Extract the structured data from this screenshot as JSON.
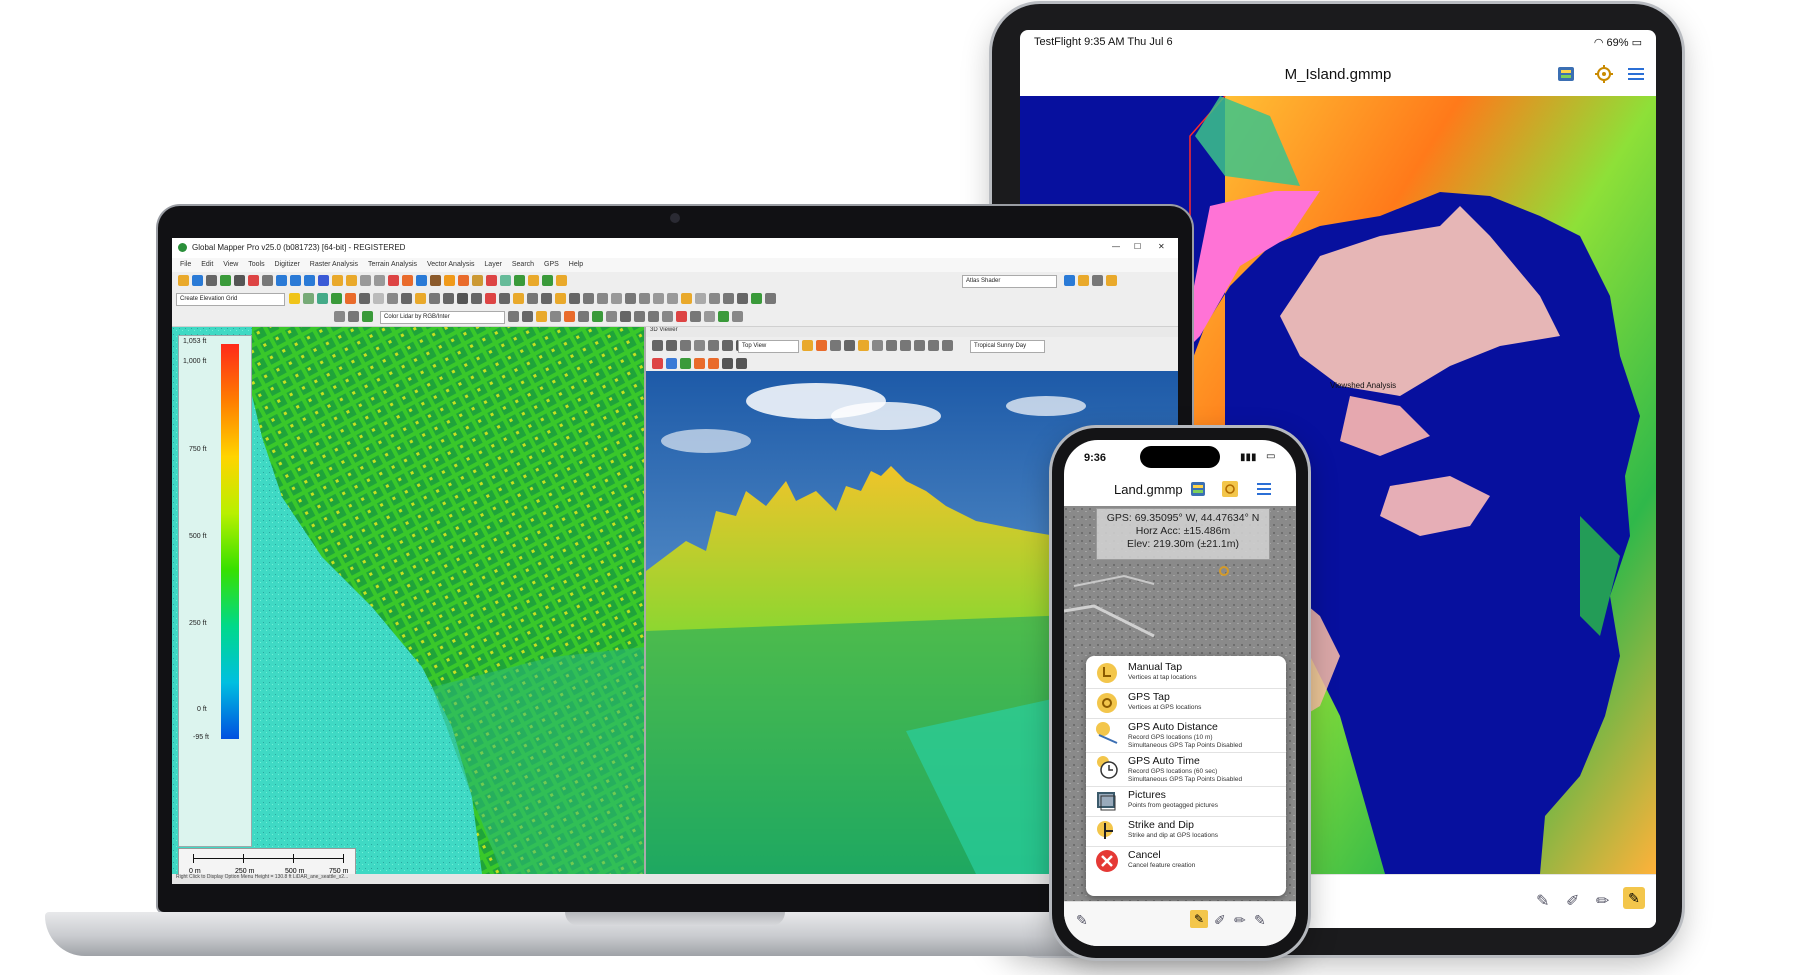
{
  "ipad": {
    "status_left": "TestFlight  9:35 AM   Thu Jul 6",
    "status_right": "69%",
    "title": "M_Island.gmmp",
    "map_label": "Viewshed Analysis",
    "icons": [
      "layers-icon",
      "locate-icon",
      "menu-icon"
    ],
    "bottom_tools": [
      "draw-line-icon",
      "draw-area-icon",
      "measure-icon",
      "digitize-icon"
    ]
  },
  "laptop": {
    "window_title": "Global Mapper Pro v25.0 (b081723) [64-bit] - REGISTERED",
    "menu": [
      "File",
      "Edit",
      "View",
      "Tools",
      "Digitizer",
      "Raster Analysis",
      "Terrain Analysis",
      "Vector Analysis",
      "Layer",
      "Search",
      "GPS",
      "Help"
    ],
    "combo_shader": "Atlas Shader",
    "combo_elev": "Create Elevation Grid",
    "combo_color": "Color Lidar by RGB/Inter",
    "view3d_title": "3D Viewer",
    "combo_view": "Top View",
    "combo_sky": "Tropical Sunny Day",
    "legend_ticks": [
      "1,053 ft",
      "1,000 ft",
      "750 ft",
      "500 ft",
      "250 ft",
      "0 ft",
      "-95 ft"
    ],
    "scale_labels": [
      "0 m",
      "250 m",
      "500 m",
      "750 m"
    ],
    "status": "Right Click to Display Option Menu   Height = 130.8 ft   LiDAR_ane_seattle_x2...",
    "legend_colors": [
      "#ff2a1a",
      "#ff7d00",
      "#ffd400",
      "#b8f000",
      "#37e000",
      "#00d98a",
      "#00bfe0",
      "#0050e0"
    ]
  },
  "iphone": {
    "time": "9:36",
    "title": "Land.gmmp",
    "gps_line1": "GPS: 69.35095° W, 44.47634° N",
    "gps_line2": "Horz Acc: ±15.486m",
    "gps_line3": "Elev: 219.30m (±21.1m)",
    "menu": [
      {
        "title": "Manual Tap",
        "sub": "Vertices at tap locations"
      },
      {
        "title": "GPS Tap",
        "sub": "Vertices at GPS locations"
      },
      {
        "title": "GPS Auto Distance",
        "sub": "Record GPS locations (10 m)\nSimultaneous GPS Tap Points Disabled"
      },
      {
        "title": "GPS Auto Time",
        "sub": "Record GPS locations (60 sec)\nSimultaneous GPS Tap Points Disabled"
      },
      {
        "title": "Pictures",
        "sub": "Points from geotagged pictures"
      },
      {
        "title": "Strike and Dip",
        "sub": "Strike and dip at GPS locations"
      },
      {
        "title": "Cancel",
        "sub": "Cancel feature creation"
      }
    ]
  }
}
